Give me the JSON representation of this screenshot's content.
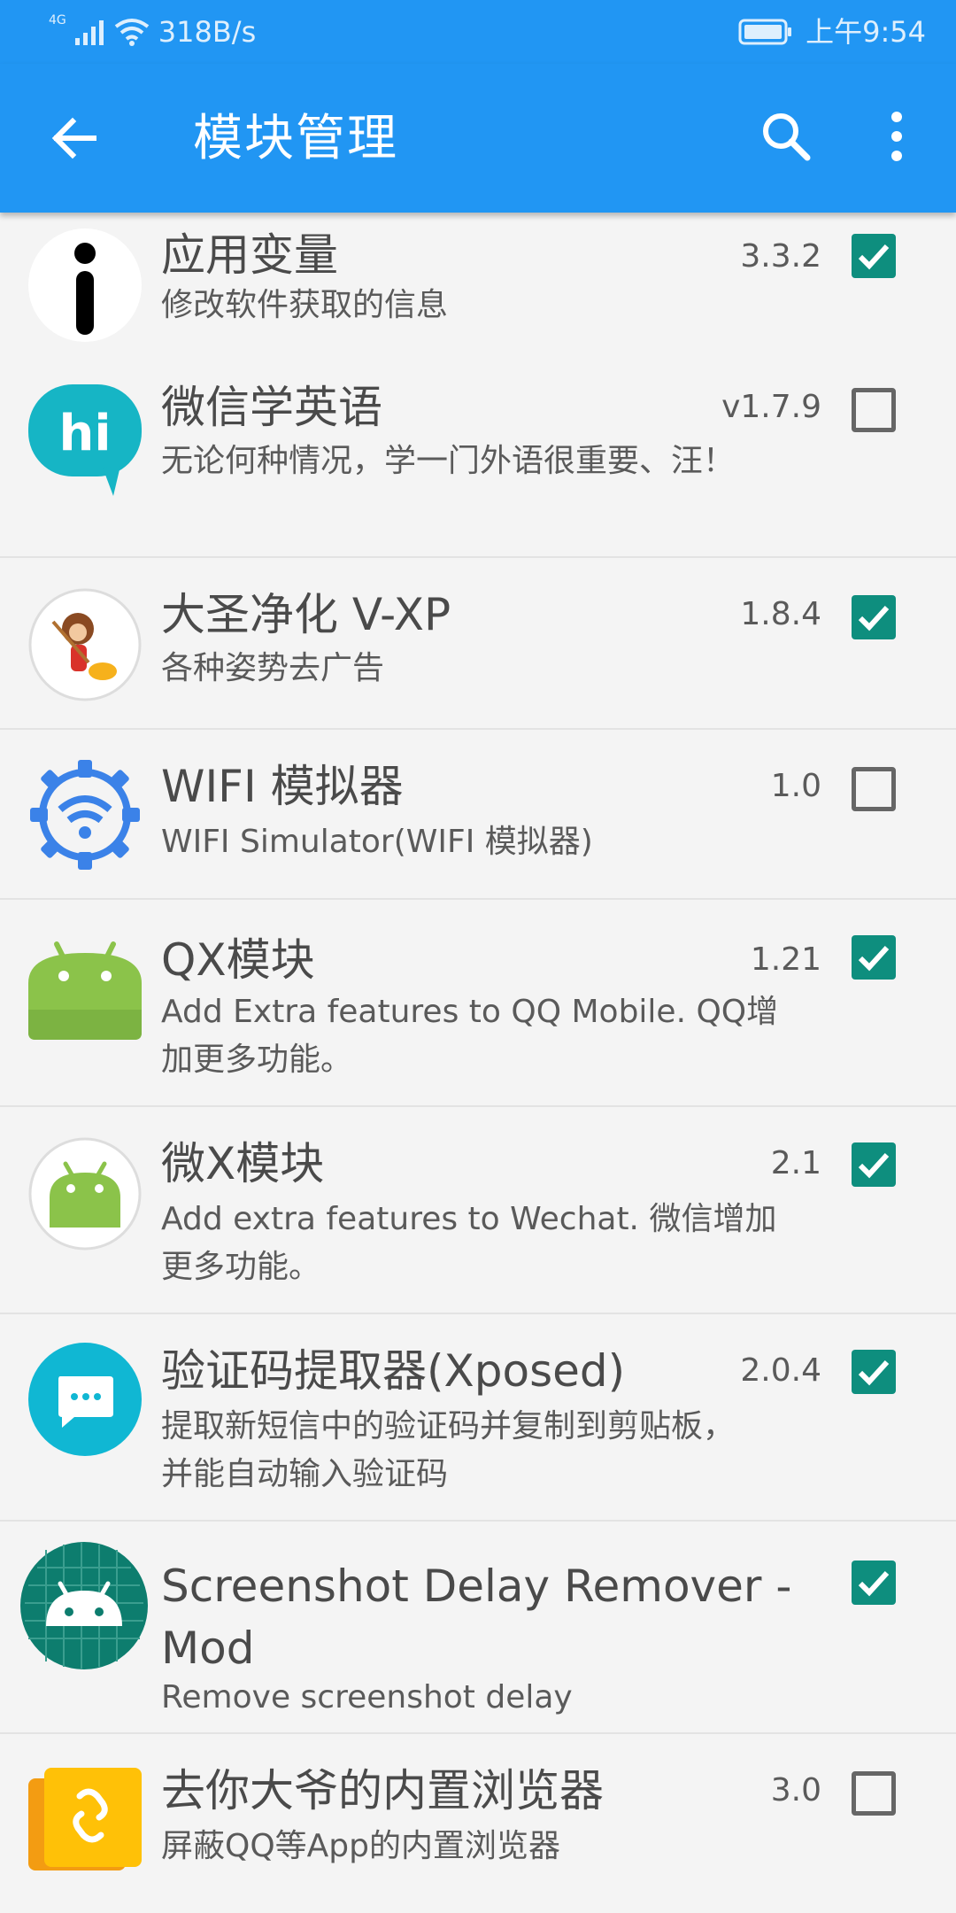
{
  "status": {
    "network": "4G",
    "speed": "318B/s",
    "time": "上午9:54"
  },
  "appbar": {
    "title": "模块管理",
    "back_icon": "arrow-back-icon",
    "search_icon": "search-icon",
    "more_icon": "more-vert-icon"
  },
  "colors": {
    "primary": "#2196F3",
    "check": "#0e8e7e"
  },
  "modules": [
    {
      "name": "应用变量",
      "version": "3.3.2",
      "desc": "修改软件获取的信息",
      "checked": true
    },
    {
      "name": "微信学英语",
      "version": "v1.7.9",
      "desc": "无论何种情况，学一门外语很重要、汪！",
      "checked": false
    },
    {
      "name": "大圣净化 V-XP",
      "version": "1.8.4",
      "desc": "各种姿势去广告",
      "checked": true
    },
    {
      "name": "WIFI 模拟器",
      "version": "1.0",
      "desc": "WIFI Simulator(WIFI 模拟器)",
      "checked": false
    },
    {
      "name": "QX模块",
      "version": "1.21",
      "desc": "Add Extra features to QQ Mobile. QQ增加更多功能。",
      "checked": true
    },
    {
      "name": "微X模块",
      "version": "2.1",
      "desc": "Add extra features to Wechat. 微信增加更多功能。",
      "checked": true
    },
    {
      "name": "验证码提取器(Xposed)",
      "version": "2.0.4",
      "desc": "提取新短信中的验证码并复制到剪贴板，并能自动输入验证码",
      "checked": true
    },
    {
      "name": "Screenshot Delay Remover - Mod",
      "version": "",
      "desc": "Remove screenshot delay",
      "checked": true
    },
    {
      "name": "去你大爷的内置浏览器",
      "version": "3.0",
      "desc": "屏蔽QQ等App的内置浏览器",
      "checked": false
    }
  ]
}
